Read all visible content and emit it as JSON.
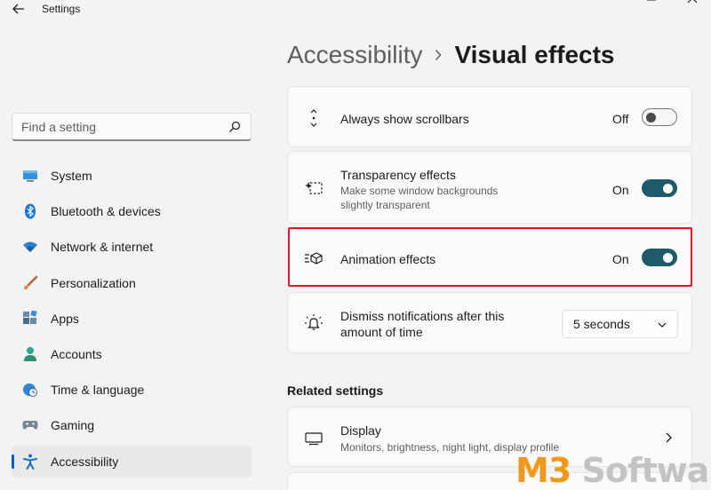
{
  "app": {
    "title": "Settings"
  },
  "search": {
    "placeholder": "Find a setting"
  },
  "sidebar": {
    "items": [
      {
        "label": "System",
        "icon": "monitor-icon"
      },
      {
        "label": "Bluetooth & devices",
        "icon": "bluetooth-icon"
      },
      {
        "label": "Network & internet",
        "icon": "wifi-icon"
      },
      {
        "label": "Personalization",
        "icon": "brush-icon"
      },
      {
        "label": "Apps",
        "icon": "apps-icon"
      },
      {
        "label": "Accounts",
        "icon": "person-icon"
      },
      {
        "label": "Time & language",
        "icon": "globe-clock-icon"
      },
      {
        "label": "Gaming",
        "icon": "gamepad-icon"
      },
      {
        "label": "Accessibility",
        "icon": "accessibility-icon",
        "active": true
      }
    ]
  },
  "breadcrumb": {
    "parent": "Accessibility",
    "current": "Visual effects"
  },
  "settings": {
    "scrollbars": {
      "title": "Always show scrollbars",
      "state": "Off",
      "on": false,
      "icon": "scrollbar-icon"
    },
    "transparency": {
      "title": "Transparency effects",
      "desc": "Make some window backgrounds slightly transparent",
      "state": "On",
      "on": true,
      "icon": "transparency-icon"
    },
    "animation": {
      "title": "Animation effects",
      "state": "On",
      "on": true,
      "icon": "animation-icon"
    },
    "notifications": {
      "title": "Dismiss notifications after this amount of time",
      "value": "5 seconds",
      "icon": "notification-bell-icon"
    }
  },
  "related": {
    "title": "Related settings",
    "display": {
      "title": "Display",
      "desc": "Monitors, brightness, night light, display profile",
      "icon": "display-icon"
    }
  },
  "watermark": {
    "prefix": "M3",
    "suffix": " Software"
  },
  "colors": {
    "accent": "#005fb8",
    "toggle_on": "#1f5a6b",
    "highlight": "#e0162b",
    "watermark_orange": "#f1991f"
  }
}
